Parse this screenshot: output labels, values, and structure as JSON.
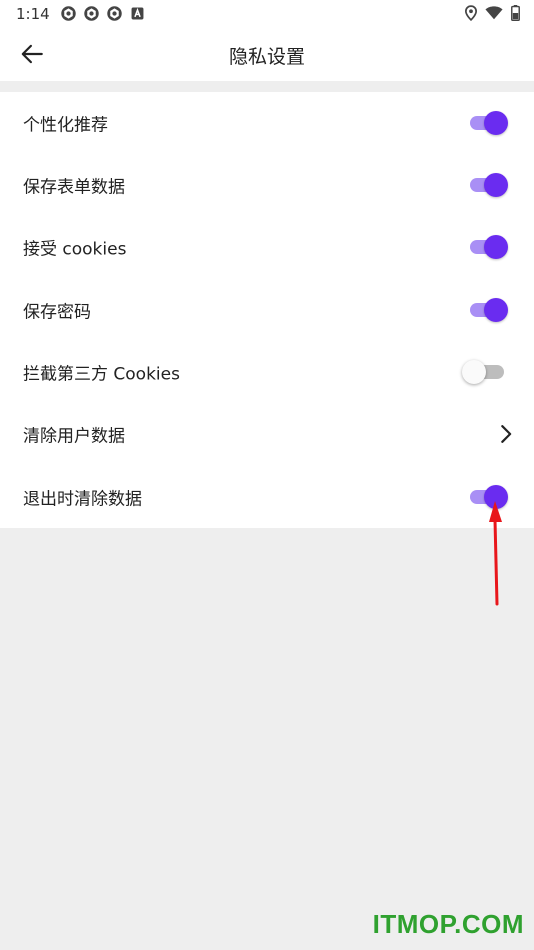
{
  "status_bar": {
    "time": "1:14",
    "left_icons": [
      "aperture-icon",
      "aperture-icon",
      "aperture-icon",
      "a-box-icon"
    ],
    "right_icons": [
      "location-icon",
      "wifi-icon",
      "battery-icon"
    ]
  },
  "app_bar": {
    "back_icon": "arrow-left-icon",
    "title": "隐私设置"
  },
  "settings": [
    {
      "label": "个性化推荐",
      "control": "switch",
      "on": true
    },
    {
      "label": "保存表单数据",
      "control": "switch",
      "on": true
    },
    {
      "label": "接受 cookies",
      "control": "switch",
      "on": true
    },
    {
      "label": "保存密码",
      "control": "switch",
      "on": true
    },
    {
      "label": "拦截第三方 Cookies",
      "control": "switch",
      "on": false
    },
    {
      "label": "清除用户数据",
      "control": "chevron"
    },
    {
      "label": "退出时清除数据",
      "control": "switch",
      "on": true
    }
  ],
  "colors": {
    "accent": "#6a2cf0",
    "accent_track": "#a98ff5",
    "annotation_arrow": "#e8161b",
    "watermark": "#2fa12f",
    "background": "#eeeeee"
  },
  "watermark": "ITMOP.COM"
}
